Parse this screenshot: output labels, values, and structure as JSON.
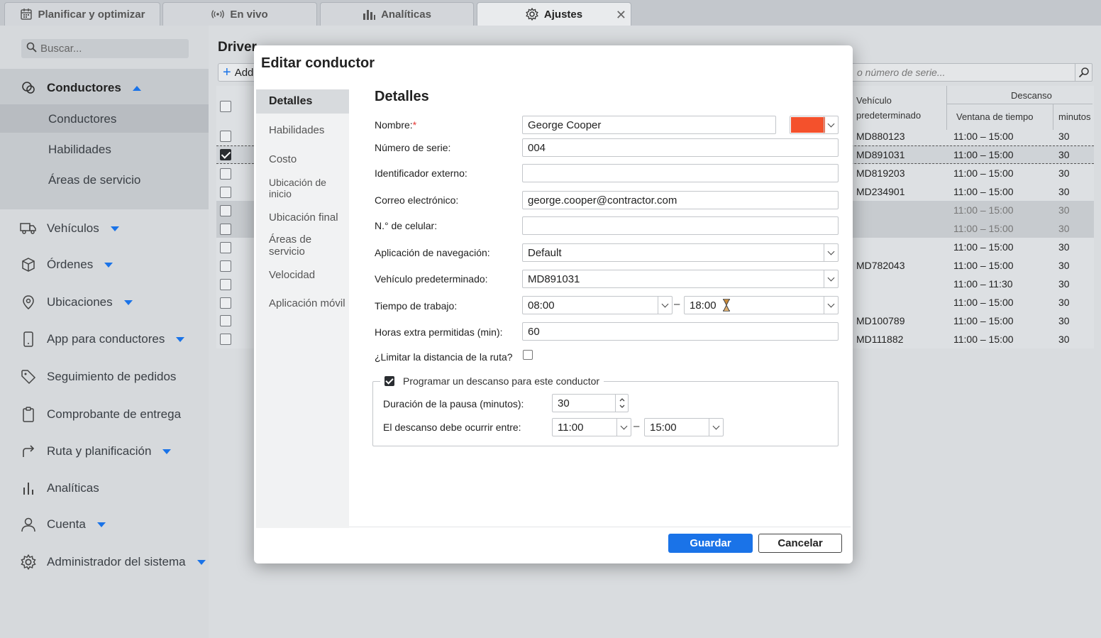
{
  "tabs": [
    {
      "label": "Planificar y optimizar",
      "icon": "calendar-icon"
    },
    {
      "label": "En vivo",
      "icon": "broadcast-icon"
    },
    {
      "label": "Analíticas",
      "icon": "bar-chart-icon"
    },
    {
      "label": "Ajustes",
      "icon": "gear-icon"
    }
  ],
  "sidebar": {
    "search_placeholder": "Buscar...",
    "group_label": "Conductores",
    "sub_items": [
      "Conductores",
      "Habilidades",
      "Áreas de servicio"
    ],
    "items": [
      {
        "label": "Vehículos",
        "icon": "truck-icon"
      },
      {
        "label": "Órdenes",
        "icon": "box-icon"
      },
      {
        "label": "Ubicaciones",
        "icon": "location-pin-icon"
      },
      {
        "label": "App para conductores",
        "icon": "phone-icon"
      },
      {
        "label": "Seguimiento de pedidos",
        "icon": "tag-icon"
      },
      {
        "label": "Comprobante de entrega",
        "icon": "clipboard-icon"
      },
      {
        "label": "Ruta y planificación",
        "icon": "route-arrow-icon"
      },
      {
        "label": "Analíticas",
        "icon": "analytics-icon"
      },
      {
        "label": "Cuenta",
        "icon": "user-icon"
      },
      {
        "label": "Administrador del sistema",
        "icon": "gear-icon"
      }
    ]
  },
  "page": {
    "title": "Driver",
    "add_label": "Add",
    "serial_search_placeholder": "o número de serie..."
  },
  "table": {
    "headers": {
      "vehicle": "Vehículo predeterminado",
      "break": "Descanso",
      "window": "Ventana de tiempo",
      "minutes": "minutos"
    },
    "rows": [
      {
        "vehicle": "MD880123",
        "window": "11:00 – 15:00",
        "minutes": "30"
      },
      {
        "vehicle": "MD891031",
        "window": "11:00 – 15:00",
        "minutes": "30"
      },
      {
        "vehicle": "MD819203",
        "window": "11:00 – 15:00",
        "minutes": "30"
      },
      {
        "vehicle": "MD234901",
        "window": "11:00 – 15:00",
        "minutes": "30"
      },
      {
        "vehicle": "",
        "window": "11:00 – 15:00",
        "minutes": "30"
      },
      {
        "vehicle": "",
        "window": "11:00 – 15:00",
        "minutes": "30"
      },
      {
        "vehicle": "",
        "window": "11:00 – 15:00",
        "minutes": "30"
      },
      {
        "vehicle": "MD782043",
        "window": "11:00 – 15:00",
        "minutes": "30"
      },
      {
        "vehicle": "",
        "window": "11:00 – 11:30",
        "minutes": "30"
      },
      {
        "vehicle": "",
        "window": "11:00 – 15:00",
        "minutes": "30"
      },
      {
        "vehicle": "MD100789",
        "window": "11:00 – 15:00",
        "minutes": "30"
      },
      {
        "vehicle": "MD111882",
        "window": "11:00 – 15:00",
        "minutes": "30"
      }
    ]
  },
  "modal": {
    "title": "Editar conductor",
    "side_tabs": [
      "Detalles",
      "Habilidades",
      "Costo",
      "Ubicación de inicio",
      "Ubicación final",
      "Áreas de servicio",
      "Velocidad",
      "Aplicación móvil"
    ],
    "section_title": "Detalles",
    "labels": {
      "name": "Nombre:",
      "serial": "Número de serie:",
      "external_id": "Identificador externo:",
      "email": "Correo electrónico:",
      "phone": "N.° de celular:",
      "nav_app": "Aplicación de navegación:",
      "default_vehicle": "Vehículo predeterminado:",
      "work_time": "Tiempo de trabajo:",
      "overtime": "Horas extra permitidas (min):",
      "limit_distance": "¿Limitar la distancia de la ruta?",
      "schedule_break": "Programar un descanso para este conductor",
      "break_duration": "Duración de la pausa (minutos):",
      "break_between": "El descanso debe ocurrir entre:"
    },
    "values": {
      "name": "George Cooper",
      "serial": "004",
      "external_id": "",
      "email": "george.cooper@contractor.com",
      "phone": "",
      "nav_app": "Default",
      "default_vehicle": "MD891031",
      "work_start": "08:00",
      "work_end": "18:00",
      "overtime": "60",
      "break_duration": "30",
      "break_start": "11:00",
      "break_end": "15:00"
    },
    "color": "#f4512c",
    "save_label": "Guardar",
    "cancel_label": "Cancelar"
  }
}
